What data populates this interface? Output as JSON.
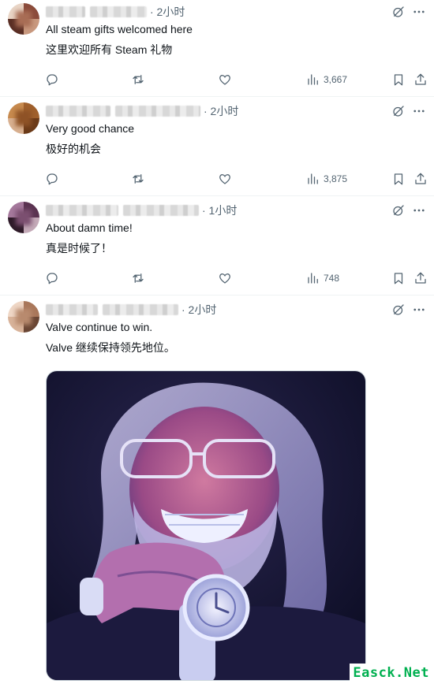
{
  "tweets": [
    {
      "time": "· 2小时",
      "text_en": "All steam gifts welcomed here",
      "text_zh": "这里欢迎所有 Steam 礼物",
      "views": "3,667",
      "avatar_colors": [
        "#8b4b3a",
        "#c9997f",
        "#5a2e24",
        "#e2c4b0"
      ]
    },
    {
      "time": "· 2小时",
      "text_en": "Very good chance",
      "text_zh": "极好的机会",
      "views": "3,875",
      "avatar_colors": [
        "#a0602c",
        "#6b3a18",
        "#c78a4e",
        "#d8b090"
      ]
    },
    {
      "time": "· 1小时",
      "text_en": "About damn time!",
      "text_zh": "真是时候了！",
      "views": "748",
      "avatar_colors": [
        "#5a3350",
        "#a5799c",
        "#2e1a28",
        "#c4aab8"
      ]
    },
    {
      "time": "· 2小时",
      "text_en": "Valve continue to win.",
      "text_zh": "Valve 继续保持领先地位。",
      "views": "",
      "avatar_colors": [
        "#a9775a",
        "#d8b39a",
        "#6a4634",
        "#efd7c6"
      ]
    }
  ],
  "watermark": "Easck.Net",
  "icons": {
    "reply": "reply-icon",
    "retweet": "retweet-icon",
    "like": "like-icon",
    "views": "views-icon",
    "bookmark": "bookmark-icon",
    "share": "share-icon",
    "grok": "grok-icon",
    "more": "more-icon"
  }
}
